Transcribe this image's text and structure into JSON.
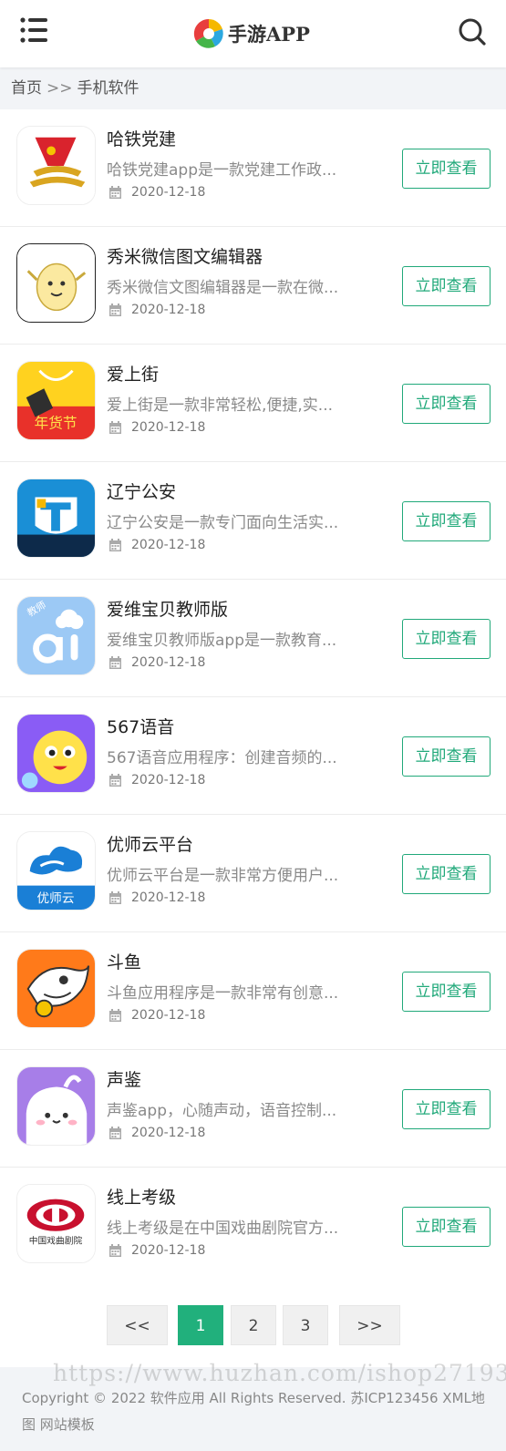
{
  "header": {
    "logo_text": "手游APP"
  },
  "breadcrumb": {
    "home": "首页",
    "sep": ">>",
    "current": "手机软件"
  },
  "list": [
    {
      "title": "哈铁党建",
      "desc": "哈铁党建app是一款党建工作政...",
      "date": "2020-12-18",
      "button": "立即查看",
      "icon": "party-building-icon"
    },
    {
      "title": "秀米微信图文编辑器",
      "desc": "秀米微信文图编辑器是一款在微...",
      "date": "2020-12-18",
      "button": "立即查看",
      "icon": "xiumi-icon"
    },
    {
      "title": "爱上街",
      "desc": "爱上街是一款非常轻松,便捷,实...",
      "date": "2020-12-18",
      "button": "立即查看",
      "icon": "shopping-bag-icon"
    },
    {
      "title": "辽宁公安",
      "desc": "辽宁公安是一款专门面向生活实...",
      "date": "2020-12-18",
      "button": "立即查看",
      "icon": "police-shield-icon"
    },
    {
      "title": "爱维宝贝教师版",
      "desc": "爱维宝贝教师版app是一款教育...",
      "date": "2020-12-18",
      "button": "立即查看",
      "icon": "ai-teacher-icon"
    },
    {
      "title": "567语音",
      "desc": "567语音应用程序：创建音频的...",
      "date": "2020-12-18",
      "button": "立即查看",
      "icon": "voice-mascot-icon"
    },
    {
      "title": "优师云平台",
      "desc": "优师云平台是一款非常方便用户...",
      "date": "2020-12-18",
      "button": "立即查看",
      "icon": "cloud-platform-icon"
    },
    {
      "title": "斗鱼",
      "desc": "斗鱼应用程序是一款非常有创意...",
      "date": "2020-12-18",
      "button": "立即查看",
      "icon": "fish-mascot-icon"
    },
    {
      "title": "声鉴",
      "desc": "声鉴app，心随声动，语音控制...",
      "date": "2020-12-18",
      "button": "立即查看",
      "icon": "ghost-mascot-icon"
    },
    {
      "title": "线上考级",
      "desc": "线上考级是在中国戏曲剧院官方...",
      "date": "2020-12-18",
      "button": "立即查看",
      "icon": "opera-theatre-icon"
    }
  ],
  "icon_logo_text": {
    "ai-teacher": "教师",
    "cloud-platform": "优师云",
    "shopping-bag": "年货节",
    "opera-theatre": "中国戏曲剧院"
  },
  "pagination": {
    "prev": "<<",
    "pages": [
      "1",
      "2",
      "3"
    ],
    "current": "1",
    "next": ">>"
  },
  "footer": {
    "watermark": "https://www.huzhan.com/ishop27193",
    "copyright": "Copyright © 2022 软件应用 All Rights Reserved. 苏ICP123456 XML地图 网站模板"
  },
  "colors": {
    "accent": "#21a97a",
    "page_active": "#21b07c",
    "background": "#f2f4f7"
  }
}
